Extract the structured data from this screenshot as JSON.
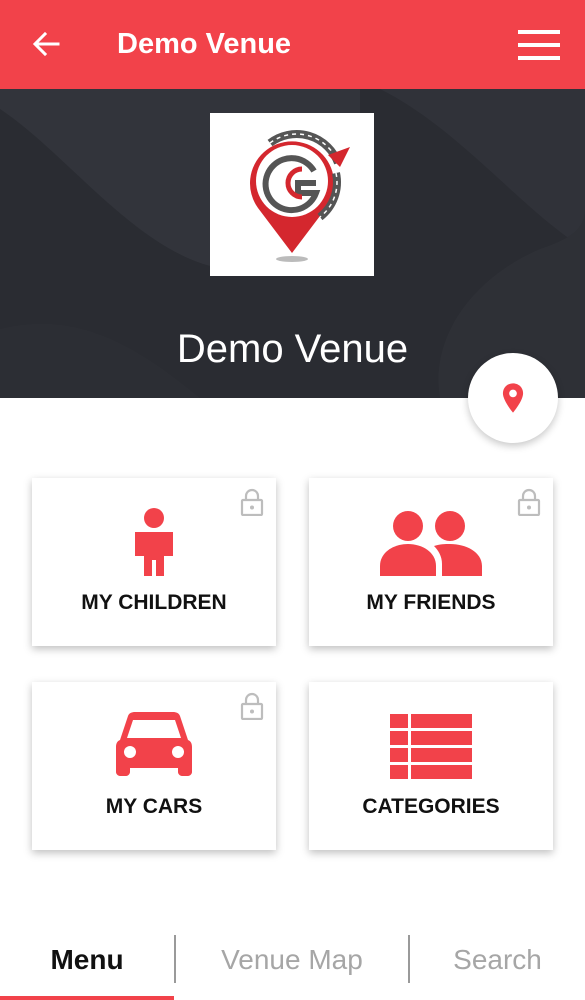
{
  "appbar": {
    "title": "Demo Venue",
    "back_icon": "arrow-left-icon",
    "menu_icon": "hamburger-menu-icon"
  },
  "hero": {
    "venue_name": "Demo Venue",
    "logo_icon": "venue-logo"
  },
  "location_button": {
    "icon": "map-pin-icon"
  },
  "cards": [
    {
      "label": "MY CHILDREN",
      "icon": "child-icon",
      "locked": true
    },
    {
      "label": "MY FRIENDS",
      "icon": "friends-icon",
      "locked": true
    },
    {
      "label": "MY CARS",
      "icon": "car-icon",
      "locked": true
    },
    {
      "label": "CATEGORIES",
      "icon": "list-icon",
      "locked": false
    }
  ],
  "tabs": [
    {
      "label": "Menu",
      "active": true
    },
    {
      "label": "Venue Map",
      "active": false
    },
    {
      "label": "Search",
      "active": false
    }
  ],
  "colors": {
    "accent": "#f2424a",
    "hero_bg": "#2b2d33",
    "lock": "#bdbdbd"
  }
}
